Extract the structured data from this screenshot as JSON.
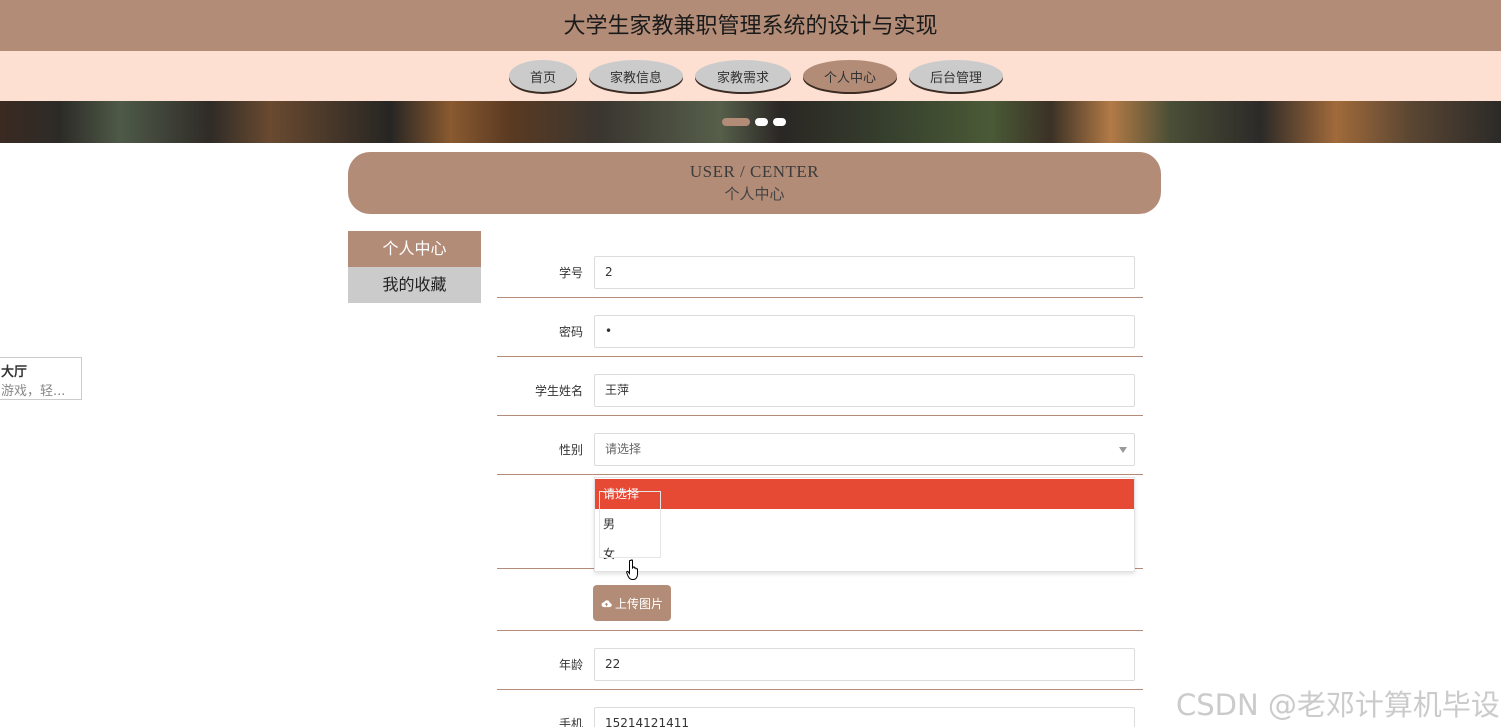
{
  "site": {
    "title": "大学生家教兼职管理系统的设计与实现"
  },
  "nav": {
    "items": [
      {
        "label": "首页"
      },
      {
        "label": "家教信息"
      },
      {
        "label": "家教需求"
      },
      {
        "label": "个人中心"
      },
      {
        "label": "后台管理"
      }
    ],
    "active": "个人中心"
  },
  "banner": {
    "slides": 3,
    "active_slide": 1
  },
  "side_popup": {
    "title": "大厅",
    "desc": "游戏，轻..."
  },
  "section": {
    "title_en": "USER / CENTER",
    "title_cn": "个人中心"
  },
  "left_menu": {
    "items": [
      {
        "label": "个人中心"
      },
      {
        "label": "我的收藏"
      }
    ],
    "active": "个人中心"
  },
  "form": {
    "student_id": {
      "label": "学号",
      "value": "2"
    },
    "password": {
      "label": "密码",
      "value": "•"
    },
    "name": {
      "label": "学生姓名",
      "value": "王萍"
    },
    "gender": {
      "label": "性别",
      "value": "请选择",
      "options": [
        "请选择",
        "男",
        "女"
      ]
    },
    "upload": {
      "label": "上传图片",
      "icon": "cloud-upload-icon"
    },
    "age": {
      "label": "年龄",
      "value": "22"
    },
    "phone": {
      "label": "手机",
      "value": "15214121411"
    }
  },
  "watermark": "CSDN @老邓计算机毕设",
  "colors": {
    "brand": "#b38c78",
    "nav_bg": "#fde0d2",
    "nav_inactive": "#cbcbcb",
    "option_selected": "#e64a35"
  }
}
